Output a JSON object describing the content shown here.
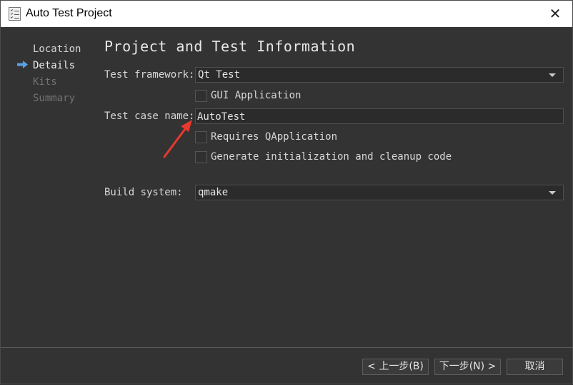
{
  "window": {
    "title": "Auto Test Project",
    "close_glyph": "✕"
  },
  "steps": [
    {
      "label": "Location",
      "state": "done"
    },
    {
      "label": "Details",
      "state": "active"
    },
    {
      "label": "Kits",
      "state": "todo"
    },
    {
      "label": "Summary",
      "state": "todo"
    }
  ],
  "page": {
    "heading": "Project and Test Information",
    "framework": {
      "label": "Test framework:",
      "value": "Qt Test"
    },
    "gui_app": {
      "label": "GUI Application",
      "checked": false
    },
    "test_case": {
      "label": "Test case name:",
      "value": "AutoTest"
    },
    "requires_qapp": {
      "label": "Requires QApplication",
      "checked": false
    },
    "gen_init": {
      "label": "Generate initialization and cleanup code",
      "checked": false
    },
    "build": {
      "label": "Build system:",
      "value": "qmake"
    }
  },
  "buttons": {
    "back": "< 上一步(B)",
    "next": "下一步(N) >",
    "cancel": "取消"
  },
  "colors": {
    "annotation_arrow": "#e8382f",
    "step_arrow": "#5aa0e6"
  }
}
